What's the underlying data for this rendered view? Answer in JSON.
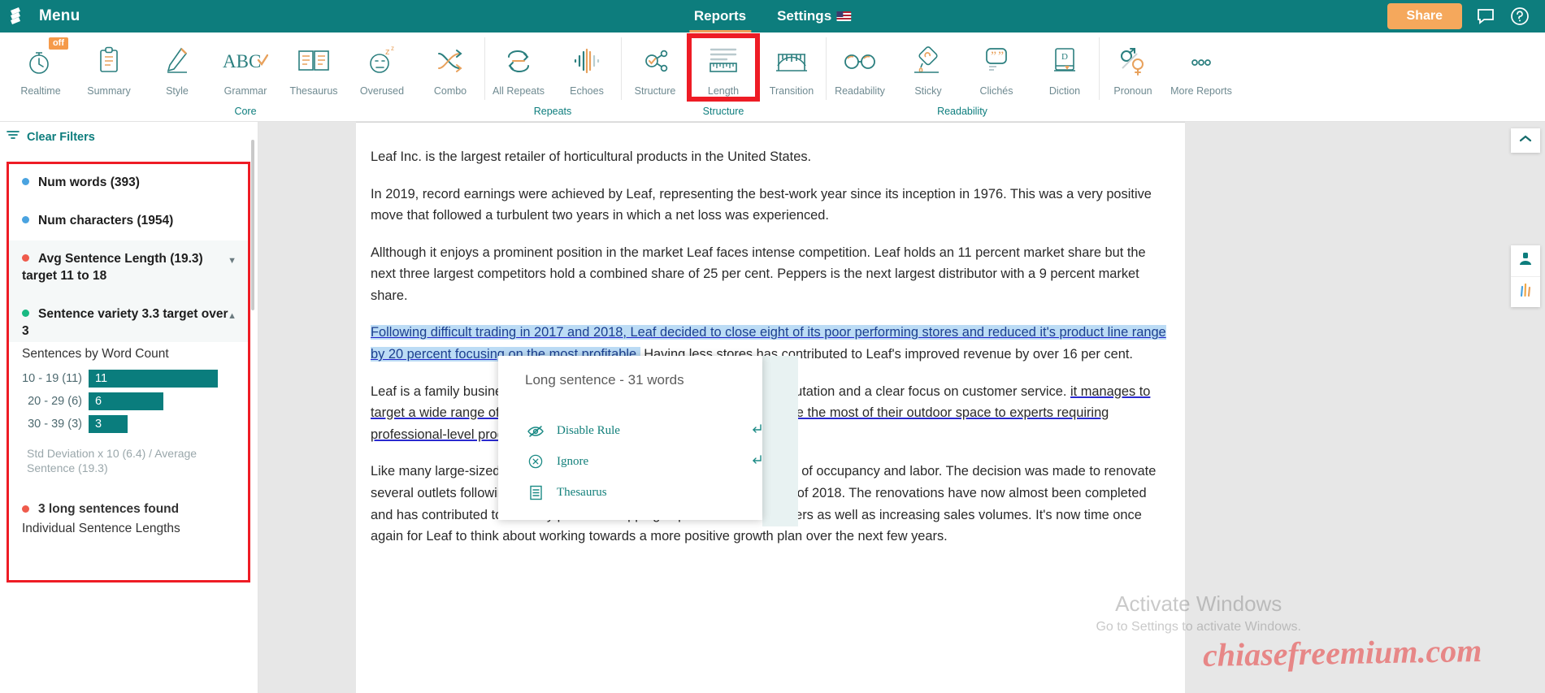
{
  "topbar": {
    "menu_label": "Menu",
    "logo_icon": "book-stack-icon",
    "nav": [
      {
        "label": "Reports",
        "active": true
      },
      {
        "label": "Settings",
        "active": false,
        "flag": "us-flag-icon"
      }
    ],
    "share_label": "Share",
    "chat_icon": "chat-bubble-icon",
    "help_icon": "question-circle-icon"
  },
  "ribbon": {
    "groups": [
      {
        "label": "Core",
        "items": [
          {
            "label": "Realtime",
            "icon": "stopwatch-icon",
            "badge": "off",
            "selected": false
          },
          {
            "label": "Summary",
            "icon": "clipboard-icon",
            "selected": false
          },
          {
            "label": "Style",
            "icon": "pencil-icon",
            "selected": false
          },
          {
            "label": "Grammar",
            "icon": "abc-check-icon",
            "selected": false
          },
          {
            "label": "Thesaurus",
            "icon": "open-book-icon",
            "selected": false
          },
          {
            "label": "Overused",
            "icon": "sleepy-face-icon",
            "selected": false
          },
          {
            "label": "Combo",
            "icon": "shuffle-arrows-icon",
            "selected": false
          }
        ]
      },
      {
        "label": "Repeats",
        "items": [
          {
            "label": "All Repeats",
            "icon": "repeat-arrows-icon",
            "selected": false
          },
          {
            "label": "Echoes",
            "icon": "waveform-icon",
            "selected": false
          }
        ]
      },
      {
        "label": "Structure",
        "items": [
          {
            "label": "Structure",
            "icon": "node-graph-icon",
            "selected": false
          },
          {
            "label": "Length",
            "icon": "ruler-icon",
            "selected": true
          },
          {
            "label": "Transition",
            "icon": "bridge-icon",
            "selected": false
          }
        ]
      },
      {
        "label": "Readability",
        "items": [
          {
            "label": "Readability",
            "icon": "glasses-icon",
            "selected": false
          },
          {
            "label": "Sticky",
            "icon": "honey-dripper-icon",
            "selected": false
          },
          {
            "label": "Clichés",
            "icon": "quote-bubble-icon",
            "selected": false
          },
          {
            "label": "Diction",
            "icon": "dictionary-book-icon",
            "selected": false
          }
        ]
      },
      {
        "label": "",
        "items": [
          {
            "label": "Pronoun",
            "icon": "gender-symbols-icon",
            "selected": false
          },
          {
            "label": "More Reports",
            "icon": "ellipsis-icon",
            "selected": false
          }
        ]
      }
    ]
  },
  "left_panel": {
    "clear_filters": "Clear Filters",
    "filter_icon": "filter-icon",
    "metrics": [
      {
        "label": "Num words (393)",
        "dot": "#4aa3e0",
        "alt": false,
        "caret": false
      },
      {
        "label": "Num characters (1954)",
        "dot": "#4aa3e0",
        "alt": false,
        "caret": false
      },
      {
        "label": "Avg Sentence Length (19.3) target 11 to 18",
        "dot": "#ef5b4c",
        "alt": true,
        "caret": "down"
      },
      {
        "label": "Sentence variety 3.3 target over 3",
        "dot": "#18b982",
        "alt": true,
        "caret": "up"
      }
    ],
    "chart_title": "Sentences by Word Count",
    "std_note": "Std Deviation x 10 (6.4) / Average Sentence (19.3)",
    "long_sentences": "3 long sentences found",
    "long_dot": "#ef5b4c",
    "individual_sentence_lengths": "Individual Sentence Lengths"
  },
  "chart_data": {
    "type": "bar",
    "title": "Sentences by Word Count",
    "orientation": "horizontal",
    "categories": [
      "10 - 19 (11)",
      "20 - 29 (6)",
      "30 - 39 (3)"
    ],
    "values": [
      11,
      6,
      3
    ],
    "bar_labels": [
      "11",
      "6",
      "3"
    ],
    "bar_color": "#0a7d7d",
    "xlabel": "",
    "ylabel": "",
    "xlim": [
      0,
      11
    ],
    "grid": false,
    "legend": "none",
    "annotation": "Std Deviation x 10 (6.4) / Average Sentence (19.3)"
  },
  "document": {
    "paragraphs": [
      {
        "id": "p1",
        "text": "Leaf Inc. is the largest retailer of horticultural products in the United States."
      },
      {
        "id": "p2",
        "text": "In 2019, record earnings were achieved by Leaf, representing the best-work year since its inception in 1976. This was a very positive move that followed a turbulent two years in which a net loss was experienced."
      },
      {
        "id": "p3",
        "text": "Allthough it enjoys a prominent position in the market Leaf faces intense competition. Leaf holds an 11 percent market share but the next three largest competitors hold a combined share of 25 per cent. Peppers is the next largest distributor with a 9 percent market share."
      },
      {
        "id": "p4a",
        "text": "Following difficult trading in 2017 and 2018, Leaf decided to close eight of its poor performing stores and reduced it's product line range by 20 percent focusing on the most profitable."
      },
      {
        "id": "p4b",
        "text": "Having less stores has contributed to Leaf's improved revenue by over 16 per cent."
      },
      {
        "id": "p5a",
        "text": "Leaf is a family business which has a long standing tradition of good reputation and a clear focus on customer service. "
      },
      {
        "id": "p5b",
        "text": "it manages to target a wide range of customers, from suburban families striving to make the most of their outdoor space to experts requiring professional-level products and advice."
      },
      {
        "id": "p6",
        "text": "Like many large-sized companies costs have risen primarily due to costs of occupancy and labor. The decision was made to renovate several outlets following the disposal of poor perofrming sites at the end of 2018. The renovations have now almost been completed and has contributed to the very positive shopping experience for customers as well as increasing sales volumes. It's now time once again for Leaf to think about working towards a more positive growth plan over the next few years."
      }
    ]
  },
  "popup": {
    "title": "Long sentence - 31 words",
    "items": [
      {
        "label": "Disable Rule",
        "icon": "eye-off-icon",
        "return_arrow": true
      },
      {
        "label": "Ignore",
        "icon": "x-circle-icon",
        "return_arrow": true
      },
      {
        "label": "Thesaurus",
        "icon": "document-lines-icon",
        "return_arrow": false
      }
    ]
  },
  "right_edge": {
    "collapse_icon": "chevron-up-icon",
    "widgets": [
      {
        "icon": "person-icon"
      },
      {
        "icon": "bar-chart-icon"
      }
    ]
  },
  "watermarks": {
    "activate_title": "Activate Windows",
    "activate_sub": "Go to Settings to activate Windows.",
    "site": "chiasefreemium.com"
  },
  "colors": {
    "teal": "#0d7d7d",
    "orange": "#f5a85c",
    "red_outline": "#ee1c25",
    "bar": "#0a7d7d",
    "highlight": "#bcdcf5"
  }
}
